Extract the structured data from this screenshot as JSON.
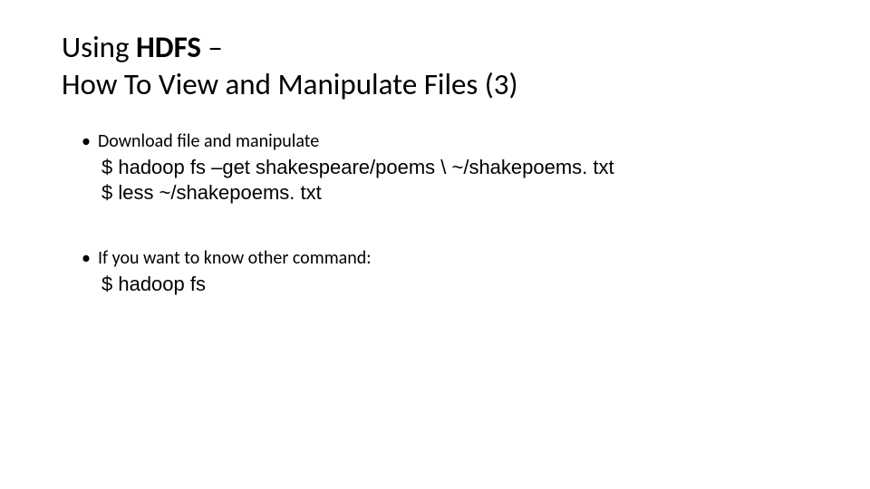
{
  "title": {
    "line1_prefix": "Using ",
    "line1_bold": "HDFS",
    "line1_suffix": " –",
    "line2": "How To View and Manipulate Files (3)"
  },
  "section1": {
    "bullet": "Download file and manipulate",
    "cmd1": "$ hadoop fs –get shakespeare/poems \\ ~/shakepoems. txt",
    "cmd2": "$ less ~/shakepoems. txt"
  },
  "section2": {
    "bullet": "If you want to know other command:",
    "cmd1": "$ hadoop fs"
  }
}
